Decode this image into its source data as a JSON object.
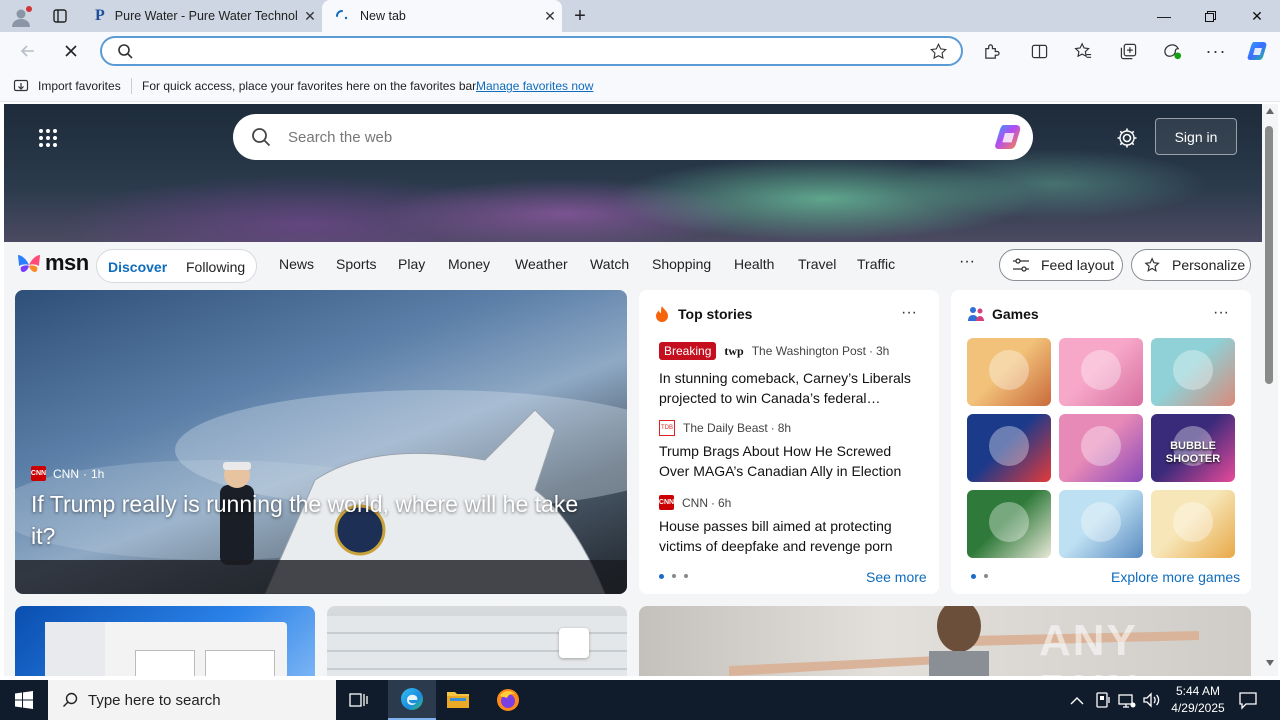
{
  "tabs": [
    {
      "title": "Pure Water - Pure Water Technol",
      "icon": "P"
    },
    {
      "title": "New tab"
    }
  ],
  "favorites_bar": {
    "import_label": "Import favorites",
    "message": "For quick access, place your favorites here on the favorites bar.",
    "link": "Manage favorites now"
  },
  "msn": {
    "search_placeholder": "Search the web",
    "sign_in": "Sign in",
    "logo": "msn",
    "tabs": [
      "Discover",
      "Following"
    ],
    "nav": [
      "News",
      "Sports",
      "Play",
      "Money",
      "Weather",
      "Watch",
      "Shopping",
      "Health",
      "Travel",
      "Traffic"
    ],
    "more": "···",
    "feed_layout": "Feed layout",
    "personalize": "Personalize"
  },
  "hero": {
    "source": "CNN",
    "age": "1h",
    "title": "If Trump really is running the world, where will he take it?"
  },
  "top_stories": {
    "header": "Top stories",
    "stories": [
      {
        "badge": "Breaking",
        "source": "The Washington Post",
        "age": "3h",
        "title": "In stunning comeback, Carney’s Liberals projected to win Canada’s federal…"
      },
      {
        "source": "The Daily Beast",
        "age": "8h",
        "title": "Trump Brags About How He Screwed Over MAGA’s Canadian Ally in Election"
      },
      {
        "source": "CNN",
        "age": "6h",
        "title": "House passes bill aimed at protecting victims of deepfake and revenge porn"
      }
    ],
    "see_more": "See more"
  },
  "games": {
    "header": "Games",
    "explore": "Explore more games",
    "tiles": [
      {
        "name": "cafe-game",
        "colors": [
          "#f2c27a",
          "#c96a3b"
        ]
      },
      {
        "name": "dress-up-game",
        "colors": [
          "#f7a8c9",
          "#d66fa0"
        ]
      },
      {
        "name": "hospital-game",
        "colors": [
          "#8fd1d6",
          "#d98a7a"
        ]
      },
      {
        "name": "block-puzzle-game",
        "colors": [
          "#1c3a8a",
          "#e33a3a"
        ]
      },
      {
        "name": "makeup-game",
        "colors": [
          "#e88ab8",
          "#8a4ab8"
        ]
      },
      {
        "name": "bubble-shooter-game",
        "colors": [
          "#3a2a7a",
          "#e84a9a"
        ],
        "label": "BUBBLE SHOOTER"
      },
      {
        "name": "mahjong-game",
        "colors": [
          "#2f7a3a",
          "#e8e8d8"
        ]
      },
      {
        "name": "stickman-thief-game",
        "colors": [
          "#bde0f2",
          "#5a8ac0"
        ]
      },
      {
        "name": "cat-game",
        "colors": [
          "#f7e6b8",
          "#e8a848"
        ]
      }
    ]
  },
  "watermark": "ANY RUN",
  "taskbar": {
    "search_placeholder": "Type here to search",
    "time": "5:44 AM",
    "date": "4/29/2025"
  },
  "colors": {
    "accent": "#0f6cbd",
    "breaking": "#c50f1f",
    "cnn": "#cc0000",
    "taskbar": "#101c2b"
  }
}
